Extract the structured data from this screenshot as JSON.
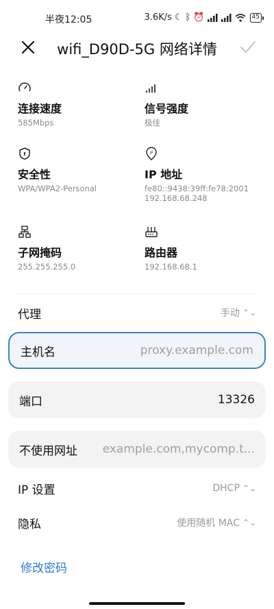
{
  "status": {
    "time": "半夜12:05",
    "speed": "3.6K/s",
    "battery": "45"
  },
  "header": {
    "title": "wifi_D90D-5G 网络详情",
    "close_icon": "close-icon",
    "confirm_icon": "check-icon"
  },
  "info": {
    "speed": {
      "label": "连接速度",
      "value": "585Mbps",
      "icon": "speedometer-icon"
    },
    "signal": {
      "label": "信号强度",
      "value": "极佳",
      "icon": "signal-bars-icon"
    },
    "security": {
      "label": "安全性",
      "value": "WPA/WPA2-Personal",
      "icon": "shield-icon"
    },
    "ip": {
      "label": "IP 地址",
      "value": "fe80::9438:39ff:fe78:2001\n192.168.68.248",
      "icon": "ip-pin-icon"
    },
    "subnet": {
      "label": "子网掩码",
      "value": "255.255.255.0",
      "icon": "network-icon"
    },
    "router": {
      "label": "路由器",
      "value": "192.168.68.1",
      "icon": "router-icon"
    }
  },
  "proxy": {
    "label": "代理",
    "value": "手动"
  },
  "hostname": {
    "label": "主机名",
    "placeholder": "proxy.example.com",
    "value": ""
  },
  "port": {
    "label": "端口",
    "value": "13326"
  },
  "bypass": {
    "label": "不使用网址",
    "placeholder": "example.com,mycomp.t..."
  },
  "ip_settings": {
    "label": "IP 设置",
    "value": "DHCP"
  },
  "privacy": {
    "label": "隐私",
    "value": "使用随机 MAC"
  },
  "change_password": "修改密码",
  "colors": {
    "accent": "#2f7bd6",
    "active_border": "#3b82c4"
  }
}
